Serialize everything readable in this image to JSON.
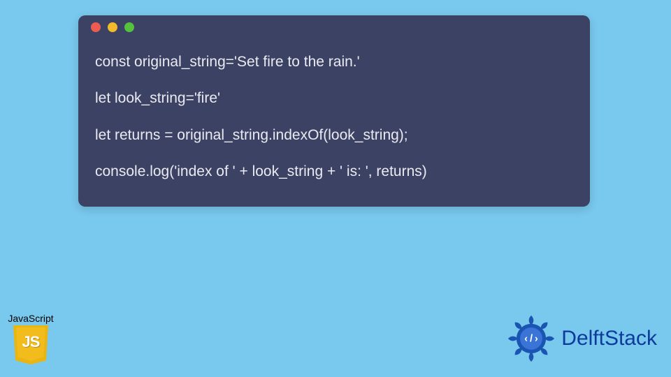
{
  "code": {
    "lines": [
      "const original_string='Set fire to the rain.'",
      "let look_string='fire'",
      "let returns = original_string.indexOf(look_string);",
      "console.log('index of ' + look_string + ' is: ', returns)"
    ]
  },
  "js_badge": {
    "label": "JavaScript",
    "logo_text": "JS"
  },
  "delft": {
    "text": "DelftStack"
  }
}
